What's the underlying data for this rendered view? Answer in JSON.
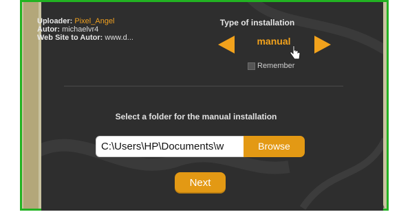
{
  "info": {
    "uploader_label": "Uploader:",
    "uploader_value": "Pixel_Angel",
    "autor_label": "Autor:",
    "autor_value": "michaelvr4",
    "website_label": "Web Site to Autor:",
    "website_value": "www.d..."
  },
  "installation": {
    "title": "Type of installation",
    "mode": "manual",
    "remember_label": "Remember"
  },
  "folder": {
    "title": "Select a folder for the manual installation",
    "path": "C:\\Users\\HP\\Documents\\w",
    "browse_label": "Browse"
  },
  "next_label": "Next",
  "colors": {
    "accent": "#e39914",
    "panel": "#2e2e2e",
    "frame": "#22b322"
  }
}
